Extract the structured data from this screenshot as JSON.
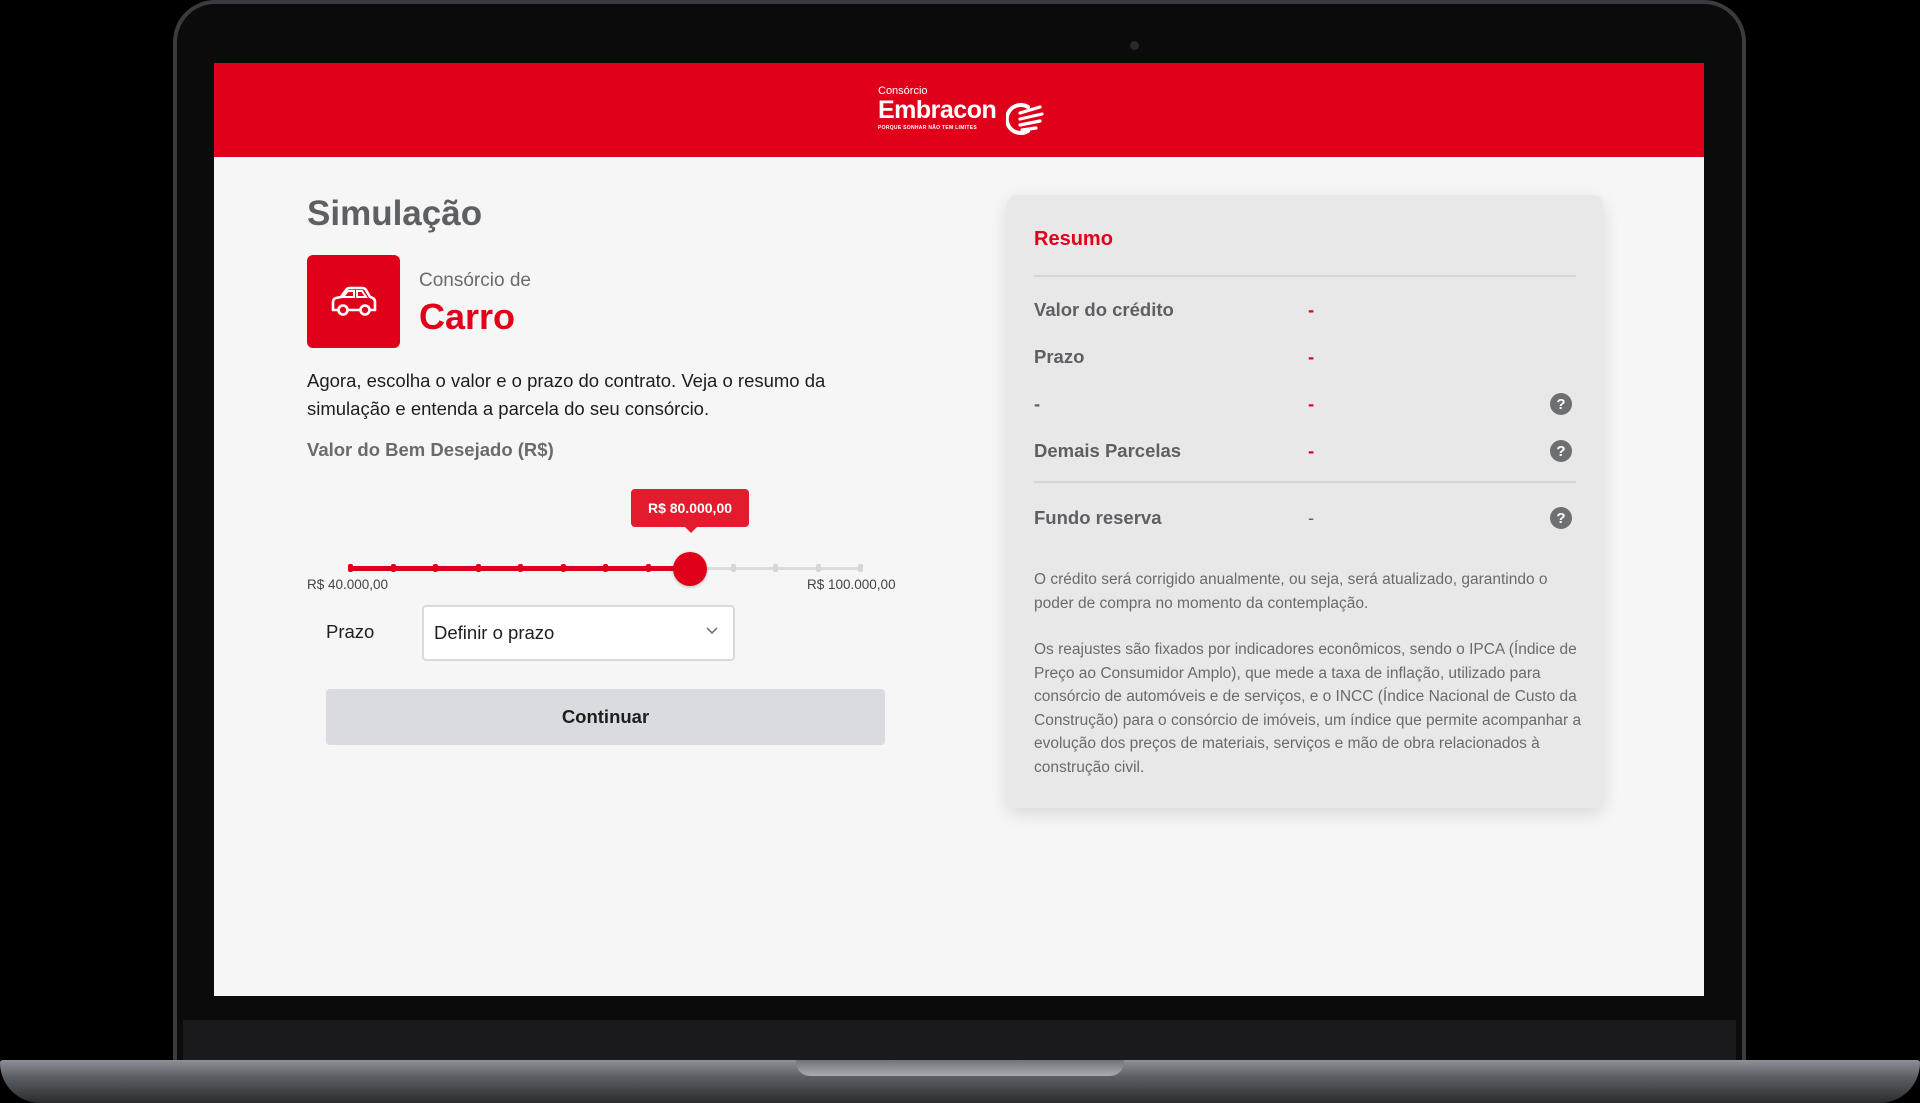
{
  "header": {
    "logo_small": "Consórcio",
    "logo_main": "Embracon",
    "logo_tag": "PORQUE SONHAR NÃO TEM LIMITES",
    "brand_color": "#e0001a"
  },
  "page": {
    "title": "Simulação",
    "product_sub": "Consórcio de",
    "product_name": "Carro",
    "product_icon": "car-icon",
    "intro": "Agora, escolha o valor e o prazo do contrato. Veja o resumo da simulação e entenda a parcela do seu consórcio."
  },
  "slider": {
    "label": "Valor do Bem Desejado (R$)",
    "min_label": "R$ 40.000,00",
    "max_label": "R$ 100.000,00",
    "value_label": "R$ 80.000,00",
    "value_fraction": 0.667,
    "ticks": 13
  },
  "prazo": {
    "label": "Prazo",
    "selected": "Definir o prazo"
  },
  "continue_label": "Continuar",
  "summary": {
    "title": "Resumo",
    "rows": [
      {
        "label": "Valor do crédito",
        "value": "-"
      },
      {
        "label": "Prazo",
        "value": "-"
      },
      {
        "label": "-",
        "value": "-"
      },
      {
        "label": "Demais Parcelas",
        "value": "-"
      }
    ],
    "reserve": {
      "label": "Fundo reserva",
      "value": "-"
    },
    "help_glyph": "?",
    "paragraph_1": "O crédito será corrigido anualmente, ou seja, será atualizado, garantindo o poder de compra no momento da contemplação.",
    "paragraph_2": "Os reajustes são fixados por indicadores econômicos, sendo o IPCA (Índice de Preço ao Consumidor Amplo), que mede a taxa de inflação, utilizado para consórcio de automóveis e de serviços, e o INCC (Índice Nacional de Custo da Construção) para o consórcio de imóveis, um índice que permite acompanhar a evolução dos preços de materiais, serviços e mão de obra relacionados à construção civil."
  }
}
